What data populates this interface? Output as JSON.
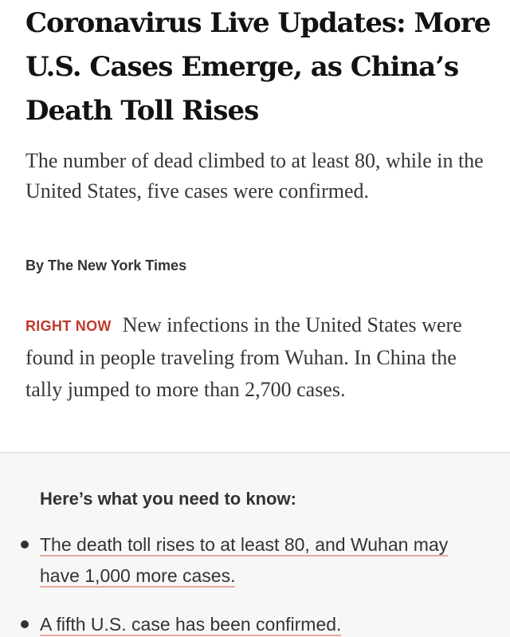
{
  "article": {
    "headline": "Coronavirus Live Updates: More U.S. Cases Emerge, as China’s Death Toll Rises",
    "summary": "The number of dead climbed to at least 80, while in the United States, five cases were confirmed.",
    "byline": "By The New York Times",
    "right_now": {
      "label": "RIGHT NOW",
      "text": "New infections in the United States were found in people traveling from Wuhan. In China the tally jumped to more than 2,700 cases."
    }
  },
  "need_to_know": {
    "title": "Here’s what you need to know:",
    "items": [
      {
        "text": "The death toll rises to at least 80, and Wuhan may have 1,000 more cases."
      },
      {
        "text": "A fifth U.S. case has been confirmed."
      }
    ]
  },
  "colors": {
    "right_now_label": "#c0392b",
    "link_underline": "#e8aaa4",
    "box_background": "#f7f7f7"
  }
}
